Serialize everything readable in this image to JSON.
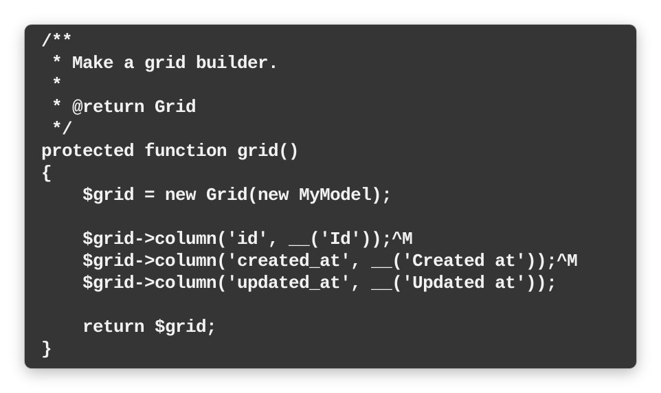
{
  "code_window": {
    "lines": [
      "/**",
      " * Make a grid builder.",
      " *",
      " * @return Grid",
      " */",
      "protected function grid()",
      "{",
      "    $grid = new Grid(new MyModel);",
      "",
      "    $grid->column('id', __('Id'));^M",
      "    $grid->column('created_at', __('Created at'));^M",
      "    $grid->column('updated_at', __('Updated at'));",
      "",
      "    return $grid;",
      "}"
    ],
    "background_color": "#353535",
    "text_color": "#f2f2f2"
  }
}
